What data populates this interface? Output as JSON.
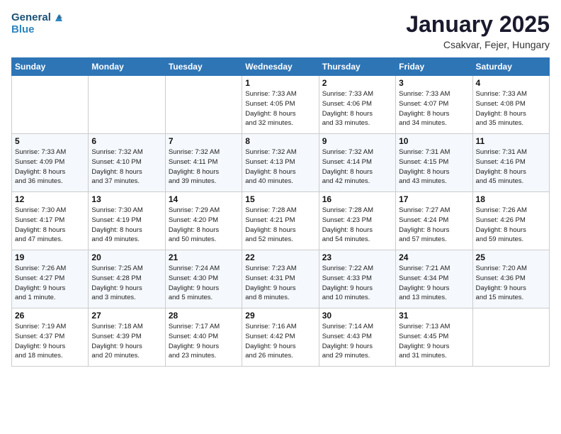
{
  "header": {
    "logo_line1": "General",
    "logo_line2": "Blue",
    "month": "January 2025",
    "location": "Csakvar, Fejer, Hungary"
  },
  "weekdays": [
    "Sunday",
    "Monday",
    "Tuesday",
    "Wednesday",
    "Thursday",
    "Friday",
    "Saturday"
  ],
  "weeks": [
    [
      {
        "day": "",
        "info": ""
      },
      {
        "day": "",
        "info": ""
      },
      {
        "day": "",
        "info": ""
      },
      {
        "day": "1",
        "info": "Sunrise: 7:33 AM\nSunset: 4:05 PM\nDaylight: 8 hours\nand 32 minutes."
      },
      {
        "day": "2",
        "info": "Sunrise: 7:33 AM\nSunset: 4:06 PM\nDaylight: 8 hours\nand 33 minutes."
      },
      {
        "day": "3",
        "info": "Sunrise: 7:33 AM\nSunset: 4:07 PM\nDaylight: 8 hours\nand 34 minutes."
      },
      {
        "day": "4",
        "info": "Sunrise: 7:33 AM\nSunset: 4:08 PM\nDaylight: 8 hours\nand 35 minutes."
      }
    ],
    [
      {
        "day": "5",
        "info": "Sunrise: 7:33 AM\nSunset: 4:09 PM\nDaylight: 8 hours\nand 36 minutes."
      },
      {
        "day": "6",
        "info": "Sunrise: 7:32 AM\nSunset: 4:10 PM\nDaylight: 8 hours\nand 37 minutes."
      },
      {
        "day": "7",
        "info": "Sunrise: 7:32 AM\nSunset: 4:11 PM\nDaylight: 8 hours\nand 39 minutes."
      },
      {
        "day": "8",
        "info": "Sunrise: 7:32 AM\nSunset: 4:13 PM\nDaylight: 8 hours\nand 40 minutes."
      },
      {
        "day": "9",
        "info": "Sunrise: 7:32 AM\nSunset: 4:14 PM\nDaylight: 8 hours\nand 42 minutes."
      },
      {
        "day": "10",
        "info": "Sunrise: 7:31 AM\nSunset: 4:15 PM\nDaylight: 8 hours\nand 43 minutes."
      },
      {
        "day": "11",
        "info": "Sunrise: 7:31 AM\nSunset: 4:16 PM\nDaylight: 8 hours\nand 45 minutes."
      }
    ],
    [
      {
        "day": "12",
        "info": "Sunrise: 7:30 AM\nSunset: 4:17 PM\nDaylight: 8 hours\nand 47 minutes."
      },
      {
        "day": "13",
        "info": "Sunrise: 7:30 AM\nSunset: 4:19 PM\nDaylight: 8 hours\nand 49 minutes."
      },
      {
        "day": "14",
        "info": "Sunrise: 7:29 AM\nSunset: 4:20 PM\nDaylight: 8 hours\nand 50 minutes."
      },
      {
        "day": "15",
        "info": "Sunrise: 7:28 AM\nSunset: 4:21 PM\nDaylight: 8 hours\nand 52 minutes."
      },
      {
        "day": "16",
        "info": "Sunrise: 7:28 AM\nSunset: 4:23 PM\nDaylight: 8 hours\nand 54 minutes."
      },
      {
        "day": "17",
        "info": "Sunrise: 7:27 AM\nSunset: 4:24 PM\nDaylight: 8 hours\nand 57 minutes."
      },
      {
        "day": "18",
        "info": "Sunrise: 7:26 AM\nSunset: 4:26 PM\nDaylight: 8 hours\nand 59 minutes."
      }
    ],
    [
      {
        "day": "19",
        "info": "Sunrise: 7:26 AM\nSunset: 4:27 PM\nDaylight: 9 hours\nand 1 minute."
      },
      {
        "day": "20",
        "info": "Sunrise: 7:25 AM\nSunset: 4:28 PM\nDaylight: 9 hours\nand 3 minutes."
      },
      {
        "day": "21",
        "info": "Sunrise: 7:24 AM\nSunset: 4:30 PM\nDaylight: 9 hours\nand 5 minutes."
      },
      {
        "day": "22",
        "info": "Sunrise: 7:23 AM\nSunset: 4:31 PM\nDaylight: 9 hours\nand 8 minutes."
      },
      {
        "day": "23",
        "info": "Sunrise: 7:22 AM\nSunset: 4:33 PM\nDaylight: 9 hours\nand 10 minutes."
      },
      {
        "day": "24",
        "info": "Sunrise: 7:21 AM\nSunset: 4:34 PM\nDaylight: 9 hours\nand 13 minutes."
      },
      {
        "day": "25",
        "info": "Sunrise: 7:20 AM\nSunset: 4:36 PM\nDaylight: 9 hours\nand 15 minutes."
      }
    ],
    [
      {
        "day": "26",
        "info": "Sunrise: 7:19 AM\nSunset: 4:37 PM\nDaylight: 9 hours\nand 18 minutes."
      },
      {
        "day": "27",
        "info": "Sunrise: 7:18 AM\nSunset: 4:39 PM\nDaylight: 9 hours\nand 20 minutes."
      },
      {
        "day": "28",
        "info": "Sunrise: 7:17 AM\nSunset: 4:40 PM\nDaylight: 9 hours\nand 23 minutes."
      },
      {
        "day": "29",
        "info": "Sunrise: 7:16 AM\nSunset: 4:42 PM\nDaylight: 9 hours\nand 26 minutes."
      },
      {
        "day": "30",
        "info": "Sunrise: 7:14 AM\nSunset: 4:43 PM\nDaylight: 9 hours\nand 29 minutes."
      },
      {
        "day": "31",
        "info": "Sunrise: 7:13 AM\nSunset: 4:45 PM\nDaylight: 9 hours\nand 31 minutes."
      },
      {
        "day": "",
        "info": ""
      }
    ]
  ]
}
